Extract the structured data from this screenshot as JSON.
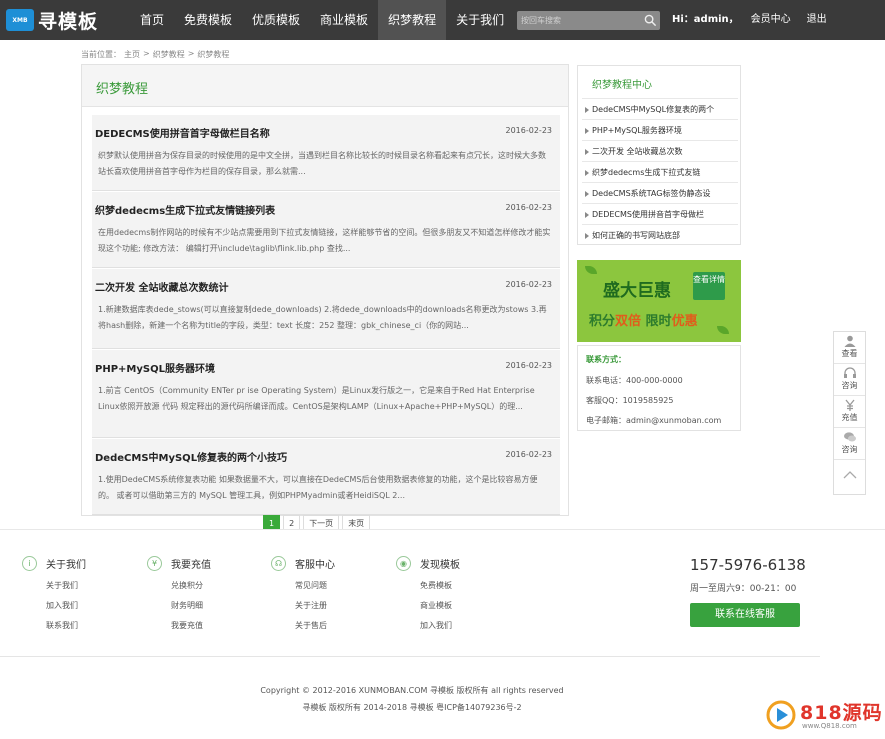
{
  "header": {
    "logo_badge": "XMB",
    "logo_text": "寻模板",
    "nav": [
      "首页",
      "免费模板",
      "优质模板",
      "商业模板",
      "织梦教程",
      "关于我们"
    ],
    "active_nav_index": 4,
    "search_placeholder": "按回车搜索",
    "greeting_prefix": "Hi：",
    "username": "admin",
    "greeting_suffix": "，",
    "member_center": "会员中心",
    "logout": "退出"
  },
  "breadcrumb": {
    "label": "当前位置：",
    "items": [
      "主页",
      "织梦教程",
      "织梦教程"
    ],
    "separator": ">"
  },
  "main": {
    "title": "织梦教程",
    "articles": [
      {
        "title": "DEDECMS使用拼音首字母做栏目名称",
        "date": "2016-02-23",
        "summary": "织梦默认使用拼音为保存目录的时候使用的是中文全拼，当遇到栏目名称比较长的时候目录名称看起来有点冗长，这时候大多数站长喜欢使用拼音首字母作为栏目的保存目录，那么就需..."
      },
      {
        "title": "织梦dedecms生成下拉式友情链接列表",
        "date": "2016-02-23",
        "summary": "在用dedecms制作网站的时候有不少站点需要用到下拉式友情链接，这样能够节省的空间。但很多朋友又不知道怎样修改才能实现这个功能; 修改方法： 编辑打开\\include\\taglib\\flink.lib.php 查找..."
      },
      {
        "title": "二次开发 全站收藏总次数统计",
        "date": "2016-02-23",
        "summary": "1.新建数据库表dede_stows(可以直接复制dede_downloads) 2.将dede_downloads中的downloads名称更改为stows 3.再将hash删除，新建一个名称为title的字段，类型：text 长度：252 整理：gbk_chinese_ci（你的网站..."
      },
      {
        "title": "PHP+MySQL服务器环境",
        "date": "2016-02-23",
        "summary": "1.前言 CentOS（Community ENTer pr ise Operating System）是Linux发行版之一，它是来自于Red Hat Enterprise Linux依照开放源 代码 规定释出的源代码所编译而成。CentOS是架构LAMP（Linux+Apache+PHP+MySQL）的理..."
      },
      {
        "title": "DedeCMS中MySQL修复表的两个小技巧",
        "date": "2016-02-23",
        "summary": "1.使用DedeCMS系统修复表功能 如果数据量不大，可以直接在DedeCMS后台使用数据表修复的功能，这个是比较容易方便的。 或者可以借助第三方的 MySQL 管理工具，例如PHPMyadmin或者HeidiSQL 2..."
      }
    ]
  },
  "pagination": {
    "pages": [
      "1",
      "2"
    ],
    "current": "1",
    "next": "下一页",
    "last": "末页"
  },
  "sidebar": {
    "title": "织梦教程中心",
    "items": [
      "DedeCMS中MySQL修复表的两个",
      "PHP+MySQL服务器环境",
      "二次开发 全站收藏总次数",
      "织梦dedecms生成下拉式友链",
      "DedeCMS系统TAG标签伪静态设",
      "DEDECMS使用拼音首字母做栏",
      "如何正确的书写网站底部"
    ]
  },
  "ad": {
    "line1": "盛大巨惠",
    "button": "查看详情",
    "line2_a": "积分",
    "line2_b": "双倍",
    "line2_c": " 限时",
    "line2_d": "优惠"
  },
  "contact": {
    "title": "联系方式：",
    "phone": "联系电话：400-000-0000",
    "qq": "客服QQ：1019585925",
    "email": "电子邮箱：admin@xunmoban.com"
  },
  "float_tools": [
    {
      "label": "查看",
      "icon": "user-icon"
    },
    {
      "label": "咨询",
      "icon": "headset-icon"
    },
    {
      "label": "充值",
      "icon": "yen-icon"
    },
    {
      "label": "咨询",
      "icon": "chat-icon"
    }
  ],
  "footer": {
    "columns": [
      {
        "title": "关于我们",
        "icon": "info-icon",
        "glyph": "i",
        "links": [
          "关于我们",
          "加入我们",
          "联系我们"
        ]
      },
      {
        "title": "我要充值",
        "icon": "yen-icon",
        "glyph": "¥",
        "links": [
          "兑换积分",
          "财务明细",
          "我要充值"
        ]
      },
      {
        "title": "客服中心",
        "icon": "headset-icon",
        "glyph": "☊",
        "links": [
          "常见问题",
          "关于注册",
          "关于售后"
        ]
      },
      {
        "title": "发现模板",
        "icon": "eye-icon",
        "glyph": "◉",
        "links": [
          "免费模板",
          "商业模板",
          "加入我们"
        ]
      }
    ],
    "phone": "157-5976-6138",
    "hours": "周一至周六9：00-21：00",
    "online_service": "联系在线客服",
    "copyright1": "Copyright © 2012-2016 XUNMOBAN.COM 寻模板 版权所有 all rights reserved",
    "copyright2": "寻模板 版权所有 2014-2018 寻模板 粤ICP备14079236号-2"
  },
  "watermark": {
    "text": "818源码",
    "url": "www.Q818.com"
  }
}
